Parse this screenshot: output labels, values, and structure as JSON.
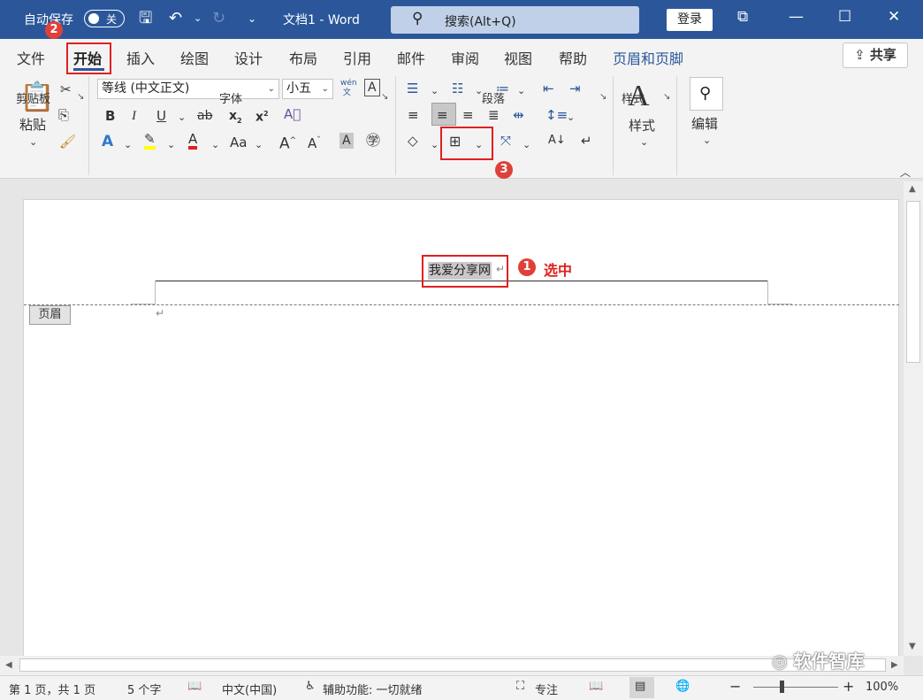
{
  "titlebar": {
    "autosave_label": "自动保存",
    "toggle_state": "关",
    "doc_title": "文档1  -  Word",
    "search_placeholder": "搜索(Alt+Q)",
    "login_label": "登录",
    "accent_color": "#2b579a"
  },
  "tabs": [
    {
      "label": "文件"
    },
    {
      "label": "开始"
    },
    {
      "label": "插入"
    },
    {
      "label": "绘图"
    },
    {
      "label": "设计"
    },
    {
      "label": "布局"
    },
    {
      "label": "引用"
    },
    {
      "label": "邮件"
    },
    {
      "label": "审阅"
    },
    {
      "label": "视图"
    },
    {
      "label": "帮助"
    },
    {
      "label": "页眉和页脚"
    }
  ],
  "share_label": "共享",
  "ribbon": {
    "clipboard": {
      "paste_label": "粘贴",
      "group_label": "剪贴板"
    },
    "font": {
      "font_name": "等线 (中文正文)",
      "font_size": "小五",
      "group_label": "字体",
      "aa_label": "Aa"
    },
    "paragraph": {
      "group_label": "段落"
    },
    "styles": {
      "label": "样式",
      "group_label": "样式"
    },
    "editing": {
      "label": "编辑"
    }
  },
  "document": {
    "header_text": "我爱分享网",
    "header_tag": "页眉",
    "annotation_label": "选中"
  },
  "badges": {
    "one": "1",
    "two": "2",
    "three": "3"
  },
  "watermark": "软件智库",
  "statusbar": {
    "page_info": "第 1 页，共 1 页",
    "word_count": "5 个字",
    "language": "中文(中国)",
    "accessibility": "辅助功能: 一切就绪",
    "focus_label": "专注",
    "zoom": "100%"
  }
}
